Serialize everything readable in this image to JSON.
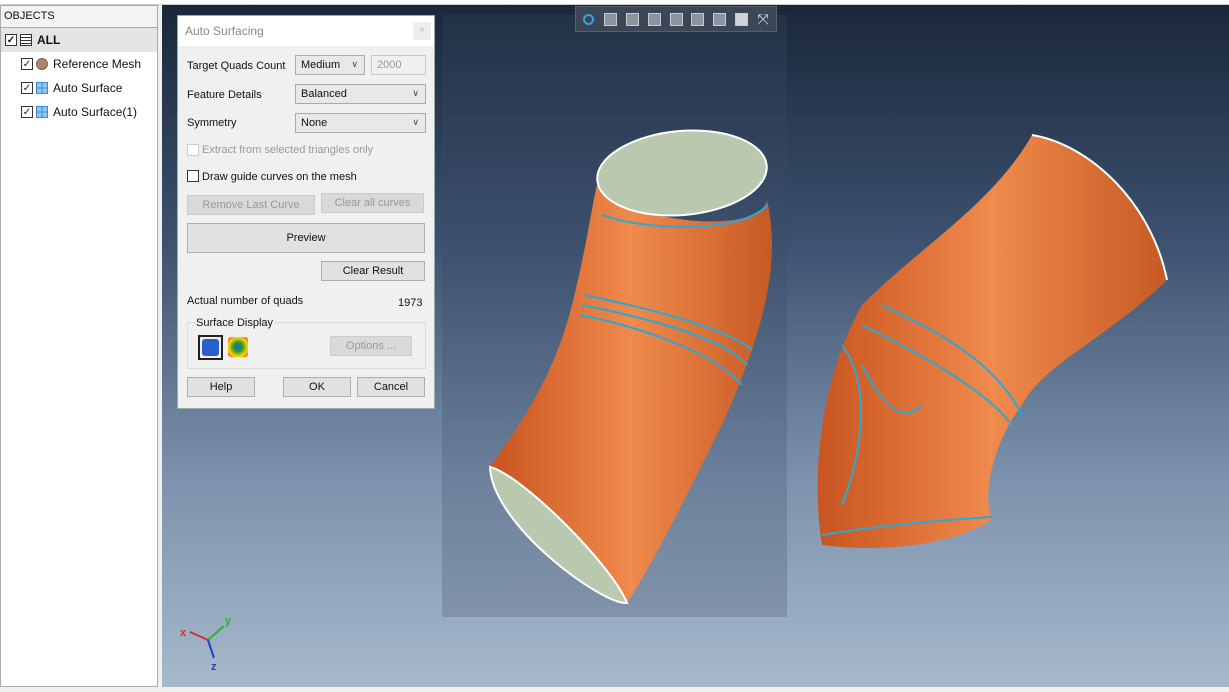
{
  "objects_panel": {
    "title": "OBJECTS",
    "items": [
      {
        "label": "ALL",
        "checked": true,
        "icon": "layers-icon"
      },
      {
        "label": "Reference Mesh",
        "checked": true,
        "icon": "mesh-icon"
      },
      {
        "label": "Auto Surface",
        "checked": true,
        "icon": "grid-surface-icon"
      },
      {
        "label": "Auto Surface(1)",
        "checked": true,
        "icon": "grid-surface-icon"
      }
    ]
  },
  "toolbar": {
    "icons": [
      "zoom-fit-icon",
      "view-front-icon",
      "view-back-icon",
      "view-left-icon",
      "view-right-icon",
      "view-top-icon",
      "view-bottom-icon",
      "view-iso-icon",
      "axes-orient-icon"
    ]
  },
  "dialog": {
    "title": "Auto Surfacing",
    "close": "×",
    "target_quads_label": "Target Quads Count",
    "target_quads_value": "Medium",
    "target_quads_count": "2000",
    "feature_details_label": "Feature Details",
    "feature_details_value": "Balanced",
    "symmetry_label": "Symmetry",
    "symmetry_value": "None",
    "extract_label": "Extract from selected triangles only",
    "extract_checked": false,
    "draw_guide_label": "Draw guide curves on the mesh",
    "draw_guide_checked": false,
    "remove_last_curve": "Remove Last Curve",
    "clear_all_curves": "Clear all curves",
    "preview": "Preview",
    "clear_result": "Clear Result",
    "actual_quads_label": "Actual number of quads",
    "actual_quads_value": "1973",
    "surface_display_label": "Surface Display",
    "options": "Options ...",
    "help": "Help",
    "ok": "OK",
    "cancel": "Cancel"
  },
  "axis": {
    "x": "x",
    "y": "y",
    "z": "z"
  },
  "colors": {
    "surface": "#e8743a",
    "guide_curves": "#2aa8d8",
    "interior": "#b8c9b0"
  }
}
